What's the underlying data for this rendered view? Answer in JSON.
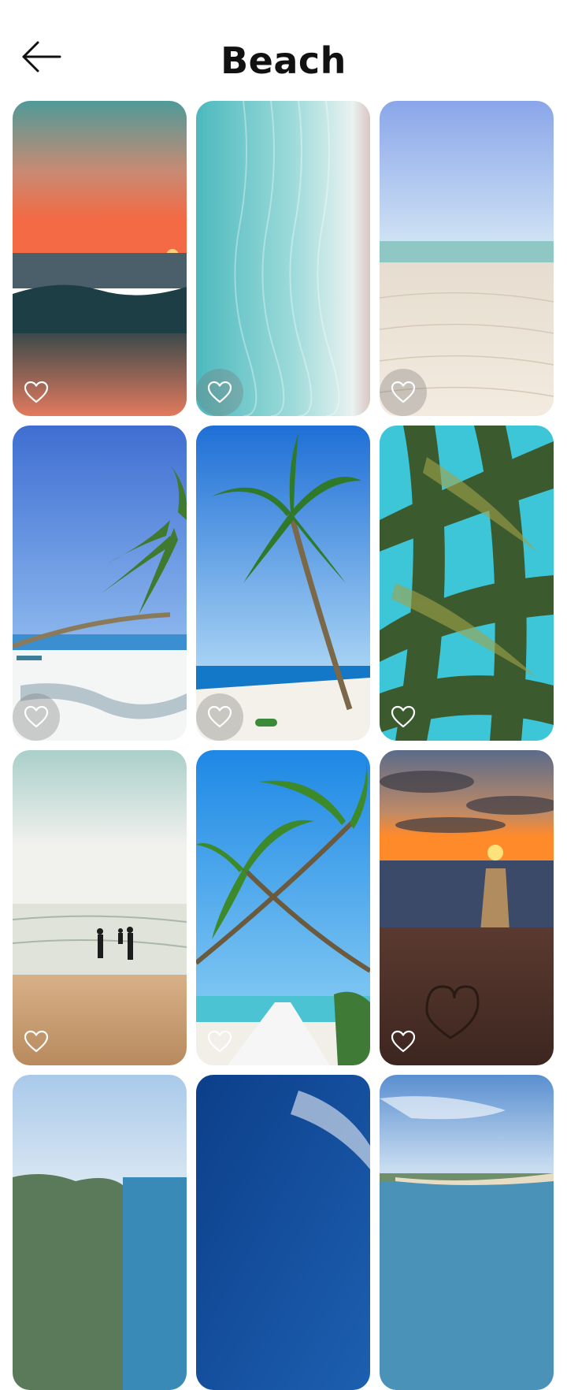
{
  "header": {
    "title": "Beach",
    "back_icon": "arrow-left-icon"
  },
  "colors": {
    "background": "#ffffff",
    "title": "#111111",
    "icon": "#ffffff"
  },
  "wallpapers": [
    {
      "scene": "sunset-waves",
      "favorite_icon": "heart-outline-icon"
    },
    {
      "scene": "turquoise-sand-aerial",
      "favorite_icon": "heart-outline-icon"
    },
    {
      "scene": "white-sand-shore",
      "favorite_icon": "heart-outline-icon"
    },
    {
      "scene": "leaning-palm-white-sand",
      "favorite_icon": "heart-outline-icon"
    },
    {
      "scene": "palm-tree-blue-sea",
      "favorite_icon": "heart-outline-icon"
    },
    {
      "scene": "palm-fronds-from-below",
      "favorite_icon": "heart-outline-icon"
    },
    {
      "scene": "people-walking-into-surf",
      "favorite_icon": "heart-outline-icon"
    },
    {
      "scene": "palms-over-pier",
      "favorite_icon": "heart-outline-icon"
    },
    {
      "scene": "sunset-heart-in-sand",
      "favorite_icon": "heart-outline-icon"
    },
    {
      "scene": "coastal-hills",
      "favorite_icon": "heart-outline-icon"
    },
    {
      "scene": "deep-blue-sky",
      "favorite_icon": "heart-outline-icon"
    },
    {
      "scene": "long-beach-horizon",
      "favorite_icon": "heart-outline-icon"
    }
  ]
}
